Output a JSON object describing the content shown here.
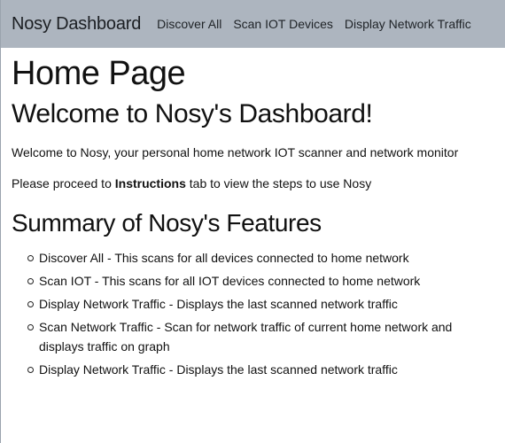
{
  "navbar": {
    "brand": "Nosy Dashboard",
    "links": [
      "Discover All",
      "Scan IOT Devices",
      "Display Network Traffic"
    ]
  },
  "main": {
    "page_title": "Home Page",
    "welcome_heading": "Welcome to Nosy's Dashboard!",
    "intro_text": "Welcome to Nosy, your personal home network IOT scanner and network monitor",
    "instructions_prefix": "Please proceed to ",
    "instructions_bold": "Instructions",
    "instructions_suffix": " tab to view the steps to use Nosy",
    "summary_heading": "Summary of Nosy's Features",
    "features": [
      "Discover All - This scans for all devices connected to home network",
      "Scan IOT - This scans for all IOT devices connected to home network",
      "Display Network Traffic - Displays the last scanned network traffic",
      "Scan Network Traffic - Scan for network traffic of current home network and displays traffic on graph",
      "Display Network Traffic - Displays the last scanned network traffic"
    ]
  },
  "colors": {
    "navbar_bg": "#adb5bf",
    "text": "#111111",
    "background": "#ffffff"
  }
}
